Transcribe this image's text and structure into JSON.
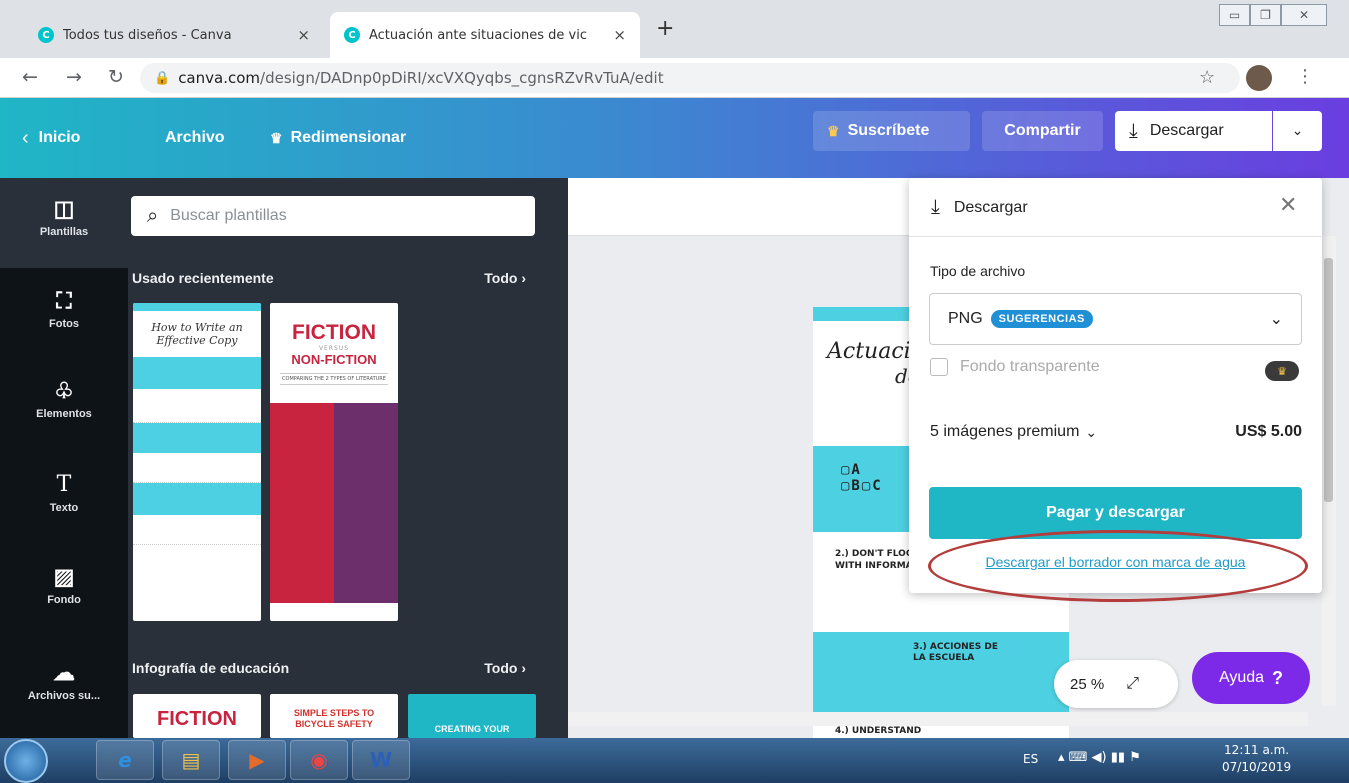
{
  "browser": {
    "tabs": [
      {
        "title": "Todos tus diseños - Canva",
        "close": "×"
      },
      {
        "title": "Actuación ante situaciones de vic",
        "close": "×"
      }
    ],
    "new_tab": "+",
    "url_host": "canva.com",
    "url_path": "/design/DADnp0pDiRI/xcVXQyqbs_cgnsRZvRvTuA/edit"
  },
  "header": {
    "home": "Inicio",
    "file": "Archivo",
    "resize": "Redimensionar",
    "subscribe": "Suscríbete",
    "share": "Compartir",
    "download": "Descargar"
  },
  "sidebar": {
    "items": [
      {
        "label": "Plantillas",
        "icon": "templates-icon"
      },
      {
        "label": "Fotos",
        "icon": "photos-icon"
      },
      {
        "label": "Elementos",
        "icon": "elements-icon"
      },
      {
        "label": "Texto",
        "icon": "text-icon"
      },
      {
        "label": "Fondo",
        "icon": "background-icon"
      },
      {
        "label": "Archivos su...",
        "icon": "uploads-icon"
      }
    ]
  },
  "panel": {
    "search_placeholder": "Buscar plantillas",
    "section1": {
      "title": "Usado recientemente",
      "all": "Todo"
    },
    "section2": {
      "title": "Infografía de educación",
      "all": "Todo"
    },
    "thumb1": {
      "title": "How to Write an Effective Copy"
    },
    "thumb2": {
      "title": "FICTION",
      "sub": "VERSUS",
      "title2": "NON-FICTION",
      "caption": "COMPARING THE 2 TYPES OF LITERATURE"
    },
    "thumb3": "FICTION",
    "thumb4": "SIMPLE STEPS TO BICYCLE SAFETY",
    "thumb5": "CREATING YOUR"
  },
  "design": {
    "title": "Actuación",
    "title2": "de",
    "step2": "2.) DON'T FLOO WITH INFORMA",
    "step3": "3.) ACCIONES DE LA ESCUELA",
    "step4": "4.) UNDERSTAND"
  },
  "download_panel": {
    "title": "Descargar",
    "file_type_label": "Tipo de archivo",
    "file_type": "PNG",
    "badge": "SUGERENCIAS",
    "transparent": "Fondo transparente",
    "premium": "5 imágenes premium",
    "price": "US$ 5.00",
    "pay_button": "Pagar y descargar",
    "watermark_link": "Descargar el borrador con marca de agua"
  },
  "canvas_controls": {
    "zoom": "25 %",
    "help": "Ayuda",
    "help_icon": "?"
  },
  "taskbar": {
    "lang": "ES",
    "time": "12:11 a.m.",
    "date": "07/10/2019"
  },
  "colors": {
    "canva_teal": "#1fb6c6",
    "canva_purple": "#7d2ae8",
    "panel_dark": "#293039",
    "annotation_red": "#b33c3c"
  }
}
